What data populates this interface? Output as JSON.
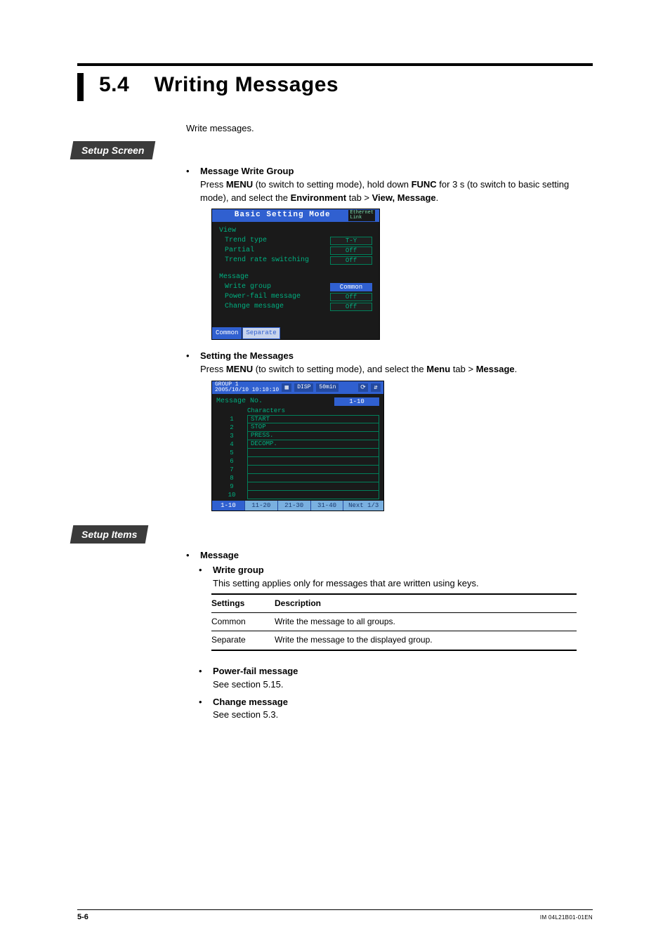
{
  "heading": {
    "number": "5.4",
    "title": "Writing Messages"
  },
  "intro": "Write messages.",
  "sec_setup_screen": "Setup Screen",
  "sec_setup_items": "Setup Items",
  "mwg": {
    "title": "Message Write Group",
    "instr_a": "Press ",
    "instr_b": "MENU",
    "instr_c": " (to switch to setting mode), hold down ",
    "instr_d": "FUNC",
    "instr_e": " for 3 s (to switch to basic setting mode), and select the ",
    "instr_f": "Environment",
    "instr_g": " tab > ",
    "instr_h": "View, Message",
    "instr_i": "."
  },
  "ss1": {
    "title": "Basic Setting Mode",
    "badge_top": "Ethernet",
    "badge_bot": "Link",
    "view_label": "View",
    "trend_type": "Trend type",
    "trend_type_v": "T-Y",
    "partial": "Partial",
    "partial_v": "Off",
    "trend_rate": "Trend rate switching",
    "trend_rate_v": "Off",
    "message_label": "Message",
    "write_group": "Write group",
    "write_group_v": "Common",
    "power_fail": "Power-fail message",
    "power_fail_v": "Off",
    "change_msg": "Change message",
    "change_msg_v": "Off",
    "soft_common": "Common",
    "soft_separate": "Separate"
  },
  "stm": {
    "title": "Setting the Messages",
    "instr_a": "Press ",
    "instr_b": "MENU",
    "instr_c": " (to switch to setting mode), and select the ",
    "instr_d": "Menu",
    "instr_e": " tab > ",
    "instr_f": "Message",
    "instr_g": "."
  },
  "ss2": {
    "group_top": "GROUP 1",
    "timestamp": "2005/10/10 10:10:10",
    "disp": "DISP",
    "rate": "50min",
    "msg_no": "Message No.",
    "range": "1-10",
    "chars": "Characters",
    "rows": [
      {
        "n": "1",
        "v": "START"
      },
      {
        "n": "2",
        "v": "STOP"
      },
      {
        "n": "3",
        "v": "PRESS."
      },
      {
        "n": "4",
        "v": "DECOMP."
      },
      {
        "n": "5",
        "v": ""
      },
      {
        "n": "6",
        "v": ""
      },
      {
        "n": "7",
        "v": ""
      },
      {
        "n": "8",
        "v": ""
      },
      {
        "n": "9",
        "v": ""
      },
      {
        "n": "10",
        "v": ""
      }
    ],
    "tab1": "1-10",
    "tab2": "11-20",
    "tab3": "21-30",
    "tab4": "31-40",
    "next": "Next 1/3"
  },
  "items": {
    "message": "Message",
    "write_group": "Write group",
    "write_group_note": "This setting applies only for messages that are written using keys.",
    "tbl_h1": "Settings",
    "tbl_h2": "Description",
    "tbl_r1_c1": "Common",
    "tbl_r1_c2": "Write the message to all groups.",
    "tbl_r2_c1": "Separate",
    "tbl_r2_c2": "Write the message to the displayed group.",
    "power_fail": "Power-fail message",
    "power_fail_note": "See section 5.15.",
    "change_msg": "Change message",
    "change_msg_note": "See section 5.3."
  },
  "footer": {
    "page": "5-6",
    "doc": "IM 04L21B01-01EN"
  }
}
